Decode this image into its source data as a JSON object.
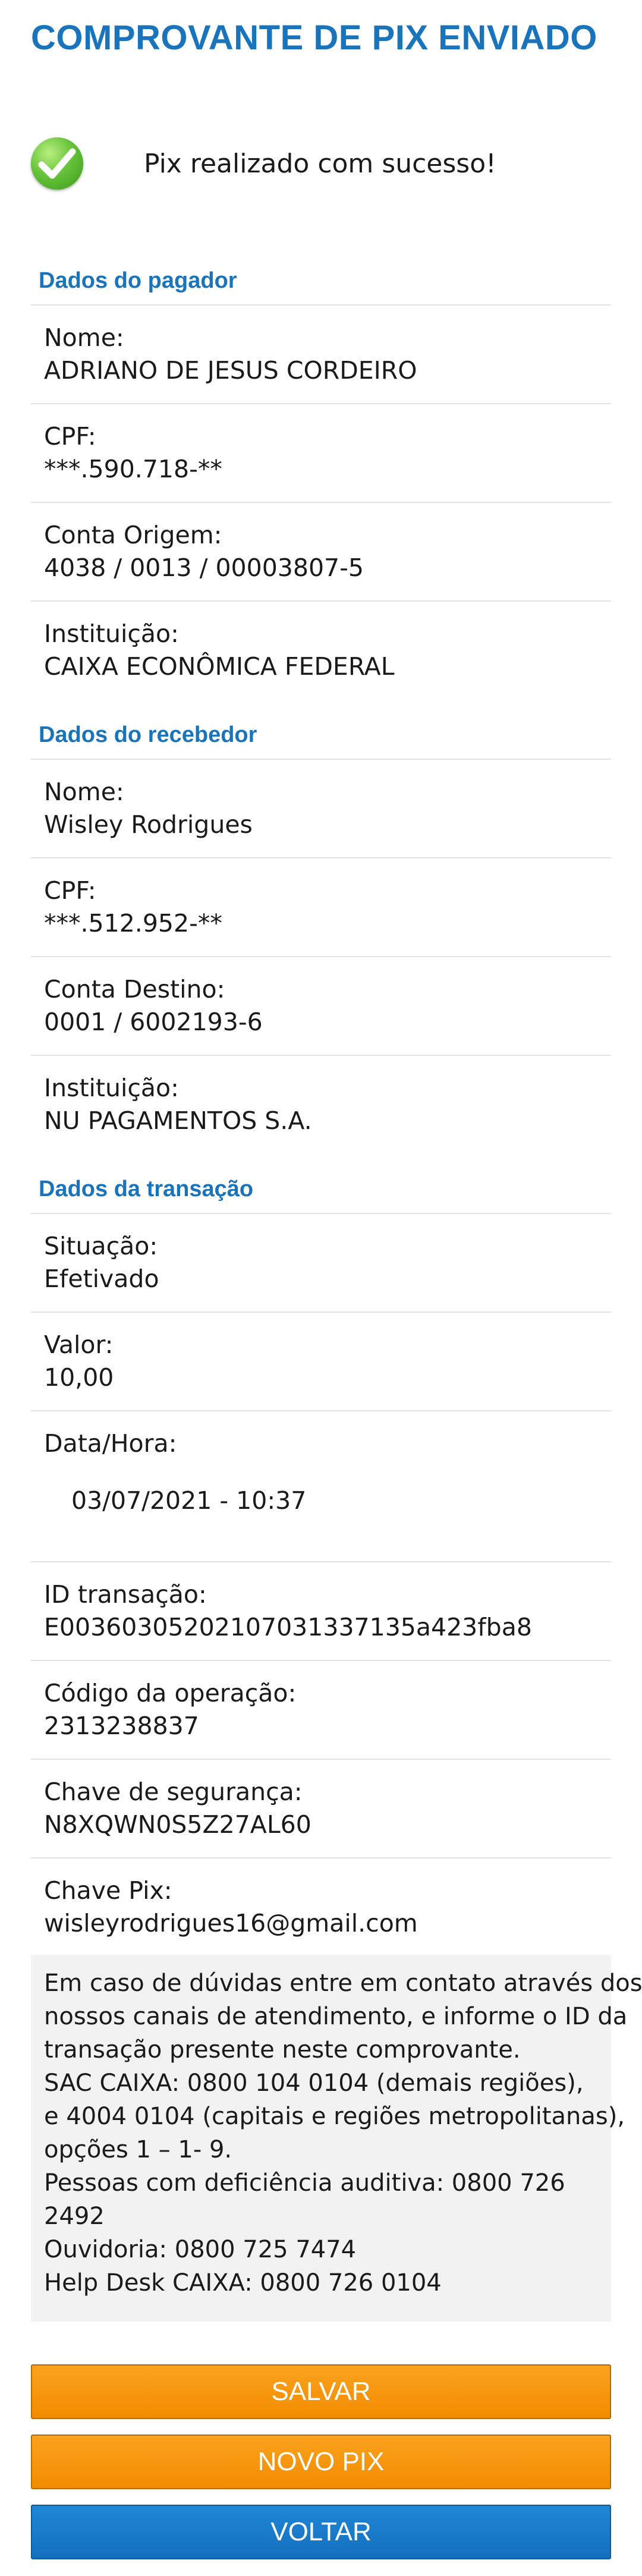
{
  "header": {
    "title": "COMPROVANTE DE PIX ENVIADO"
  },
  "status": {
    "icon": "check-circle-icon",
    "message": "Pix realizado com sucesso!"
  },
  "sections": {
    "payer": {
      "title": "Dados do pagador",
      "fields": [
        {
          "label": "Nome:",
          "value": "ADRIANO DE JESUS CORDEIRO"
        },
        {
          "label": "CPF:",
          "value": "***.590.718-**"
        },
        {
          "label": "Conta Origem:",
          "value": "4038 / 0013 / 00003807-5"
        },
        {
          "label": "Instituição:",
          "value": "CAIXA ECONÔMICA FEDERAL"
        }
      ]
    },
    "receiver": {
      "title": "Dados do recebedor",
      "fields": [
        {
          "label": "Nome:",
          "value": "Wisley Rodrigues"
        },
        {
          "label": "CPF:",
          "value": "***.512.952-**"
        },
        {
          "label": "Conta Destino:",
          "value": "0001 / 6002193-6"
        },
        {
          "label": "Instituição:",
          "value": "NU PAGAMENTOS S.A."
        }
      ]
    },
    "transaction": {
      "title": "Dados da transação",
      "fields": [
        {
          "label": "Situação:",
          "value": "Efetivado"
        },
        {
          "label": "Valor:",
          "value": "10,00"
        },
        {
          "label": "Data/Hora:",
          "value": "03/07/2021 - 10:37"
        },
        {
          "label": "ID transação:",
          "value": "E00360305202107031337135a423fba8"
        },
        {
          "label": "Código da operação:",
          "value": "2313238837"
        },
        {
          "label": "Chave de segurança:",
          "value": "N8XQWN0S5Z27AL60"
        },
        {
          "label": "Chave Pix:",
          "value": "wisleyrodrigues16@gmail.com"
        }
      ]
    }
  },
  "info": {
    "lines": [
      "Em caso de dúvidas entre em contato através dos",
      "nossos canais de atendimento, e informe o ID da",
      "transação presente neste comprovante.",
      "SAC CAIXA: 0800 104 0104 (demais regiões),",
      "e 4004 0104 (capitais e regiões metropolitanas),",
      "opções 1 – 1- 9.",
      "Pessoas com deficiência auditiva: 0800 726",
      "2492",
      "Ouvidoria: 0800 725 7474",
      "Help Desk CAIXA: 0800 726 0104"
    ]
  },
  "buttons": {
    "save": "SALVAR",
    "new_pix": "NOVO PIX",
    "back": "VOLTAR"
  },
  "colors": {
    "accent": "#1a74bb",
    "orange_button": "#f7941d",
    "blue_button": "#1a7ccc",
    "info_bg": "#f3f2f2"
  }
}
